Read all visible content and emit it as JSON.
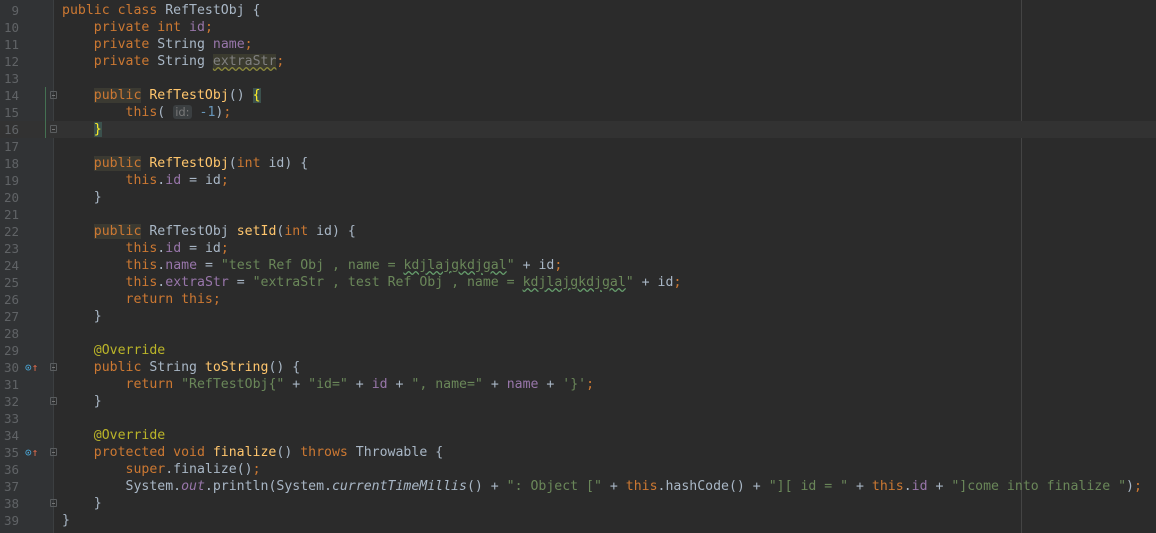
{
  "editor": {
    "current_line": 16,
    "lines": [
      {
        "n": 9,
        "t": [
          [
            "kw",
            "public class "
          ],
          [
            "",
            "RefTestObj {"
          ]
        ]
      },
      {
        "n": 10,
        "t": [
          [
            "",
            "    "
          ],
          [
            "kw",
            "private int "
          ],
          [
            "fld",
            "id"
          ],
          [
            "kw",
            ";"
          ]
        ]
      },
      {
        "n": 11,
        "t": [
          [
            "",
            "    "
          ],
          [
            "kw",
            "private "
          ],
          [
            "",
            "String "
          ],
          [
            "fld",
            "name"
          ],
          [
            "kw",
            ";"
          ]
        ]
      },
      {
        "n": 12,
        "t": [
          [
            "",
            "    "
          ],
          [
            "kw",
            "private "
          ],
          [
            "",
            "String "
          ],
          [
            "warn",
            "extraStr"
          ],
          [
            "kw",
            ";"
          ]
        ]
      },
      {
        "n": 13,
        "t": []
      },
      {
        "n": 14,
        "fold": true,
        "changed": true,
        "t": [
          [
            "",
            "    "
          ],
          [
            "kw hl",
            "public"
          ],
          [
            "kw",
            " "
          ],
          [
            "fn",
            "RefTestObj"
          ],
          [
            "",
            "() "
          ],
          [
            "brace",
            "{"
          ]
        ]
      },
      {
        "n": 15,
        "changed": true,
        "t": [
          [
            "",
            "        "
          ],
          [
            "kw",
            "this"
          ],
          [
            "",
            "( "
          ],
          [
            "hint",
            "id:"
          ],
          [
            "num",
            " -1"
          ],
          [
            "",
            ")"
          ],
          [
            "kw",
            ";"
          ]
        ]
      },
      {
        "n": 16,
        "fold": true,
        "changed": true,
        "t": [
          [
            "",
            "    "
          ],
          [
            "brace",
            "}"
          ]
        ]
      },
      {
        "n": 17,
        "t": []
      },
      {
        "n": 18,
        "t": [
          [
            "",
            "    "
          ],
          [
            "kw hl",
            "public"
          ],
          [
            "kw",
            " "
          ],
          [
            "fn",
            "RefTestObj"
          ],
          [
            "",
            "("
          ],
          [
            "kw",
            "int "
          ],
          [
            "",
            "id) {"
          ]
        ]
      },
      {
        "n": 19,
        "t": [
          [
            "",
            "        "
          ],
          [
            "kw",
            "this"
          ],
          [
            "",
            "."
          ],
          [
            "fld",
            "id"
          ],
          [
            "",
            " = id"
          ],
          [
            "kw",
            ";"
          ]
        ]
      },
      {
        "n": 20,
        "t": [
          [
            "",
            "    }"
          ]
        ]
      },
      {
        "n": 21,
        "t": []
      },
      {
        "n": 22,
        "t": [
          [
            "",
            "    "
          ],
          [
            "kw hl",
            "public"
          ],
          [
            "",
            " RefTestObj "
          ],
          [
            "fn",
            "setId"
          ],
          [
            "",
            "("
          ],
          [
            "kw",
            "int "
          ],
          [
            "",
            "id) {"
          ]
        ]
      },
      {
        "n": 23,
        "t": [
          [
            "",
            "        "
          ],
          [
            "kw",
            "this"
          ],
          [
            "",
            "."
          ],
          [
            "fld",
            "id"
          ],
          [
            "",
            " = id"
          ],
          [
            "kw",
            ";"
          ]
        ]
      },
      {
        "n": 24,
        "t": [
          [
            "",
            "        "
          ],
          [
            "kw",
            "this"
          ],
          [
            "",
            "."
          ],
          [
            "fld",
            "name"
          ],
          [
            "",
            " = "
          ],
          [
            "str",
            "\"test Ref Obj , name = "
          ],
          [
            "str typo",
            "kdjlajgkdjgal"
          ],
          [
            "str",
            "\""
          ],
          [
            "",
            " + id"
          ],
          [
            "kw",
            ";"
          ]
        ]
      },
      {
        "n": 25,
        "t": [
          [
            "",
            "        "
          ],
          [
            "kw",
            "this"
          ],
          [
            "",
            "."
          ],
          [
            "fld",
            "extraStr"
          ],
          [
            "",
            " = "
          ],
          [
            "str",
            "\"extraStr , test Ref Obj , name = "
          ],
          [
            "str typo",
            "kdjlajgkdjgal"
          ],
          [
            "str",
            "\""
          ],
          [
            "",
            " + id"
          ],
          [
            "kw",
            ";"
          ]
        ]
      },
      {
        "n": 26,
        "t": [
          [
            "",
            "        "
          ],
          [
            "kw",
            "return this;"
          ]
        ]
      },
      {
        "n": 27,
        "t": [
          [
            "",
            "    }"
          ]
        ]
      },
      {
        "n": 28,
        "t": []
      },
      {
        "n": 29,
        "t": [
          [
            "",
            "    "
          ],
          [
            "ann",
            "@Override"
          ]
        ]
      },
      {
        "n": 30,
        "fold": true,
        "override": true,
        "t": [
          [
            "",
            "    "
          ],
          [
            "kw",
            "public "
          ],
          [
            "",
            "String "
          ],
          [
            "fn",
            "toString"
          ],
          [
            "",
            "() {"
          ]
        ]
      },
      {
        "n": 31,
        "t": [
          [
            "",
            "        "
          ],
          [
            "kw",
            "return "
          ],
          [
            "str",
            "\"RefTestObj{\""
          ],
          [
            "",
            " + "
          ],
          [
            "str",
            "\"id=\""
          ],
          [
            "",
            " + "
          ],
          [
            "fld",
            "id"
          ],
          [
            "",
            " + "
          ],
          [
            "str",
            "\", name=\""
          ],
          [
            "",
            " + "
          ],
          [
            "fld",
            "name"
          ],
          [
            "",
            " + "
          ],
          [
            "str",
            "'}'"
          ],
          [
            "kw",
            ";"
          ]
        ]
      },
      {
        "n": 32,
        "fold": true,
        "t": [
          [
            "",
            "    }"
          ]
        ]
      },
      {
        "n": 33,
        "t": []
      },
      {
        "n": 34,
        "t": [
          [
            "",
            "    "
          ],
          [
            "ann",
            "@Override"
          ]
        ]
      },
      {
        "n": 35,
        "fold": true,
        "override": true,
        "t": [
          [
            "",
            "    "
          ],
          [
            "kw",
            "protected void "
          ],
          [
            "fn",
            "finalize"
          ],
          [
            "",
            "() "
          ],
          [
            "kw",
            "throws "
          ],
          [
            "",
            "Throwable {"
          ]
        ]
      },
      {
        "n": 36,
        "t": [
          [
            "",
            "        "
          ],
          [
            "kw",
            "super"
          ],
          [
            "",
            ".finalize()"
          ],
          [
            "kw",
            ";"
          ]
        ]
      },
      {
        "n": 37,
        "t": [
          [
            "",
            "        System."
          ],
          [
            "itf",
            "out"
          ],
          [
            "",
            ".println(System."
          ],
          [
            "it",
            "currentTimeMillis"
          ],
          [
            "",
            "() + "
          ],
          [
            "str",
            "\": Object [\""
          ],
          [
            "",
            " + "
          ],
          [
            "kw",
            "this"
          ],
          [
            "",
            ".hashCode() + "
          ],
          [
            "str",
            "\"][ id = \""
          ],
          [
            "",
            " + "
          ],
          [
            "kw",
            "this"
          ],
          [
            "",
            "."
          ],
          [
            "fld",
            "id"
          ],
          [
            "",
            " + "
          ],
          [
            "str",
            "\"]come into finalize \""
          ],
          [
            "",
            ")"
          ],
          [
            "kw",
            ";"
          ]
        ]
      },
      {
        "n": 38,
        "fold": true,
        "t": [
          [
            "",
            "    }"
          ]
        ]
      },
      {
        "n": 39,
        "t": [
          [
            "",
            "}"
          ]
        ]
      }
    ],
    "override_icon": "override-method-icon"
  }
}
